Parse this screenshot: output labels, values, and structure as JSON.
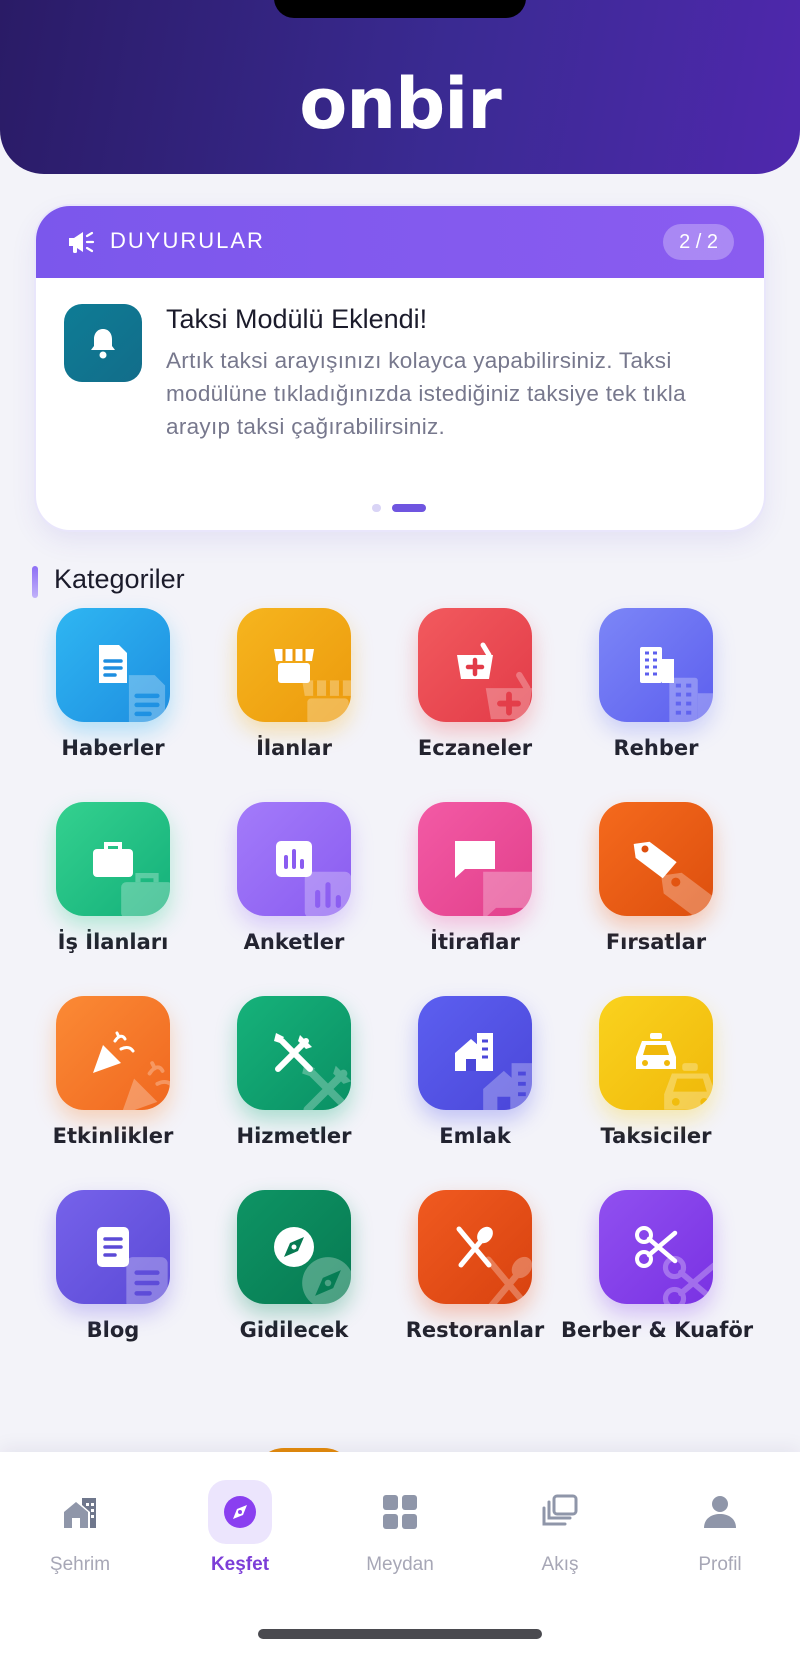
{
  "app": {
    "logo": "onbir"
  },
  "announcements": {
    "header": "DUYURULAR",
    "pager": "2 / 2",
    "title": "Taksi Modülü Eklendi!",
    "body": "Artık taksi arayışınızı kolayca yapabilirsiniz. Taksi modülüne tıkladığınızda istediğiniz taksiye tek tıkla arayıp taksi çağırabilirsiniz.",
    "active_index": 2,
    "total": 2
  },
  "categories_section": {
    "title": "Kategoriler",
    "items": [
      {
        "label": "Haberler",
        "icon": "news-icon",
        "color_from": "#2fb6f2",
        "color_to": "#1e8ee0"
      },
      {
        "label": "İlanlar",
        "icon": "storefront-icon",
        "color_from": "#f6b51e",
        "color_to": "#ec9a0d"
      },
      {
        "label": "Eczaneler",
        "icon": "pharmacy-icon",
        "color_from": "#f25a5e",
        "color_to": "#e23b48"
      },
      {
        "label": "Rehber",
        "icon": "building-icon",
        "color_from": "#7c86f7",
        "color_to": "#5d5fee"
      },
      {
        "label": "İş İlanları",
        "icon": "briefcase-icon",
        "color_from": "#34d18f",
        "color_to": "#14b07a"
      },
      {
        "label": "Anketler",
        "icon": "poll-icon",
        "color_from": "#a37bfa",
        "color_to": "#8a5cf0"
      },
      {
        "label": "İtiraflar",
        "icon": "chat-bubble-icon",
        "color_from": "#f35aa5",
        "color_to": "#e2408b"
      },
      {
        "label": "Fırsatlar",
        "icon": "tag-icon",
        "color_from": "#f56a1d",
        "color_to": "#dd4f0e"
      },
      {
        "label": "Etkinlikler",
        "icon": "party-popper-icon",
        "color_from": "#fb8a35",
        "color_to": "#f06820"
      },
      {
        "label": "Hizmetler",
        "icon": "tools-icon",
        "color_from": "#16b27a",
        "color_to": "#0a9064"
      },
      {
        "label": "Emlak",
        "icon": "house-icon",
        "color_from": "#5c5ff0",
        "color_to": "#4b47d9"
      },
      {
        "label": "Taksiciler",
        "icon": "taxi-icon",
        "color_from": "#fad21e",
        "color_to": "#f0b90b"
      },
      {
        "label": "Blog",
        "icon": "document-icon",
        "color_from": "#7662ea",
        "color_to": "#5b4ad6"
      },
      {
        "label": "Gidilecek",
        "icon": "compass-icon",
        "color_from": "#0e9464",
        "color_to": "#077a52"
      },
      {
        "label": "Restoranlar",
        "icon": "fork-spoon-icon",
        "color_from": "#f05a20",
        "color_to": "#d8420f"
      },
      {
        "label": "Berber & Kuaför",
        "icon": "scissors-icon",
        "color_from": "#9050f0",
        "color_to": "#7a32e3"
      }
    ]
  },
  "tabs": [
    {
      "label": "Şehrim",
      "icon": "city-icon",
      "active": false
    },
    {
      "label": "Keşfet",
      "icon": "compass-icon",
      "active": true
    },
    {
      "label": "Meydan",
      "icon": "grid-icon",
      "active": false
    },
    {
      "label": "Akış",
      "icon": "feed-stack-icon",
      "active": false
    },
    {
      "label": "Profil",
      "icon": "user-icon",
      "active": false
    }
  ],
  "colors": {
    "header_from": "#2a1b66",
    "header_to": "#4f28ad",
    "announcement_bar": "#7b57ec",
    "active_tab": "#7c3ed8",
    "inactive_tab": "#a7a7b6"
  }
}
